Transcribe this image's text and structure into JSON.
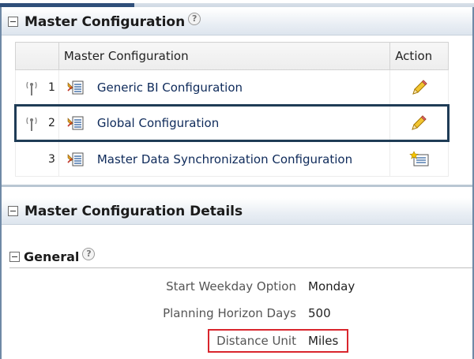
{
  "panels": {
    "master": {
      "title": "Master Configuration",
      "table": {
        "columns": [
          "Master Configuration",
          "Action"
        ],
        "rows": [
          {
            "index": "1",
            "name": "Generic BI Configuration",
            "action_icon": "pencil-edit-icon",
            "selected": false
          },
          {
            "index": "2",
            "name": "Global Configuration",
            "action_icon": "pencil-edit-icon",
            "selected": true
          },
          {
            "index": "3",
            "name": "Master Data Synchronization Configuration",
            "action_icon": "add-record-icon",
            "selected": false
          }
        ]
      }
    },
    "details": {
      "title": "Master Configuration Details",
      "general": {
        "title": "General",
        "fields": [
          {
            "label": "Start Weekday Option",
            "value": "Monday"
          },
          {
            "label": "Planning Horizon Days",
            "value": "500"
          },
          {
            "label": "Distance Unit",
            "value": "Miles"
          }
        ]
      }
    }
  },
  "colors": {
    "selection_border": "#1f3c56",
    "highlight_box": "#d9262d",
    "header_gradient_end": "#dde5ee"
  }
}
